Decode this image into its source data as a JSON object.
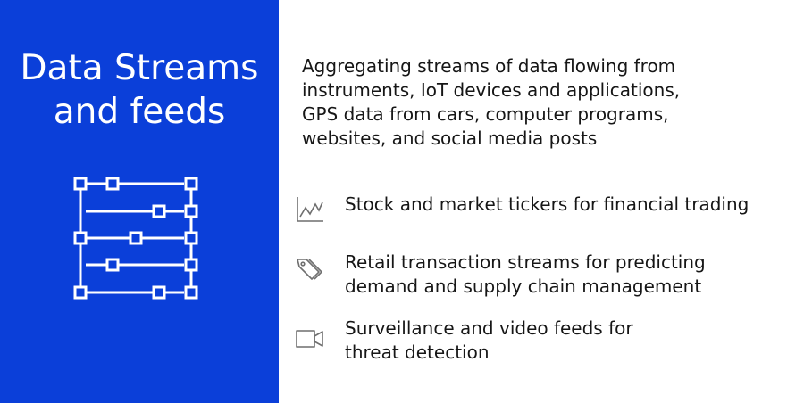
{
  "title": {
    "line1": "Data Streams",
    "line2": "and feeds"
  },
  "graphic": {
    "icon": "data-streams-icon"
  },
  "intro": {
    "lines": [
      "Aggregating streams of data flowing from",
      "instruments, IoT devices and applications,",
      "GPS data from cars, computer programs,",
      "websites, and social media posts"
    ]
  },
  "items": [
    {
      "icon": "line-chart-icon",
      "lines": [
        "Stock and market tickers for financial trading"
      ]
    },
    {
      "icon": "tags-icon",
      "lines": [
        "Retail transaction streams for predicting",
        "demand and supply chain management"
      ]
    },
    {
      "icon": "video-camera-icon",
      "lines": [
        "Surveillance and video feeds for",
        "threat detection"
      ]
    }
  ],
  "colors": {
    "brand_blue": "#0b3fd9",
    "text_dark": "#161616",
    "icon_gray": "#6f6f6f",
    "white": "#ffffff"
  }
}
